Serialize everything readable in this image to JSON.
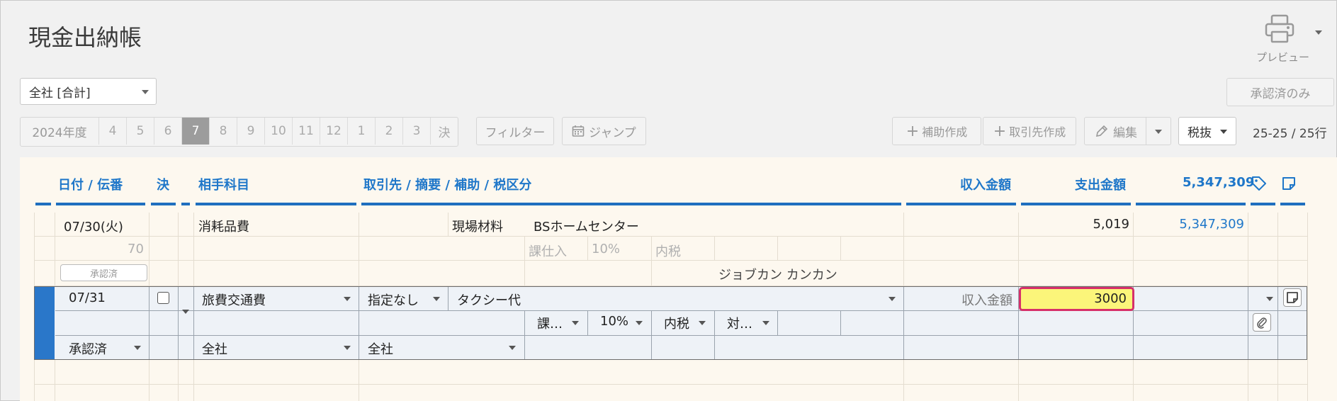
{
  "header": {
    "title": "現金出納帳",
    "preview_label": "プレビュー"
  },
  "toolbar": {
    "company_select": "全社 [合計]",
    "approved_only": "承認済のみ",
    "year": "2024年度",
    "months": [
      "4",
      "5",
      "6",
      "7",
      "8",
      "9",
      "10",
      "11",
      "12",
      "1",
      "2",
      "3",
      "決"
    ],
    "active_month": "7",
    "filter": "フィルター",
    "jump": "ジャンプ",
    "add_sub": "補助作成",
    "add_partner": "取引先作成",
    "edit": "編集",
    "tax_mode": "税抜",
    "row_count": "25-25 / 25行"
  },
  "table": {
    "headers": {
      "date": "日付 / 伝番",
      "settled": "決",
      "account": "相手科目",
      "partner": "取引先 / 摘要 / 補助 / 税区分",
      "income": "収入金額",
      "expense": "支出金額",
      "balance": "5,347,309"
    },
    "row": {
      "date": "07/30(火)",
      "number": "70",
      "status": "承認済",
      "account": "消耗品費",
      "sub": "現場材料",
      "partner": "BSホームセンター",
      "tax_cat": "課仕入",
      "tax_rate": "10%",
      "tax_type": "内税",
      "memo": "ジョブカン カンカン",
      "expense": "5,019",
      "balance": "5,347,309"
    },
    "edit_row": {
      "date": "07/31",
      "account": "旅費交通費",
      "sub": "指定なし",
      "description": "タクシー代",
      "income_placeholder": "収入金額",
      "expense_value": "3000",
      "tax_cat": "課…",
      "tax_rate": "10%",
      "tax_type": "内税",
      "target": "対…",
      "status": "承認済",
      "dept": "全社",
      "dept2": "全社"
    }
  },
  "colors": {
    "accent": "#1f77c9",
    "highlight": "#fbf57a",
    "highlight_border": "#d6306a"
  }
}
